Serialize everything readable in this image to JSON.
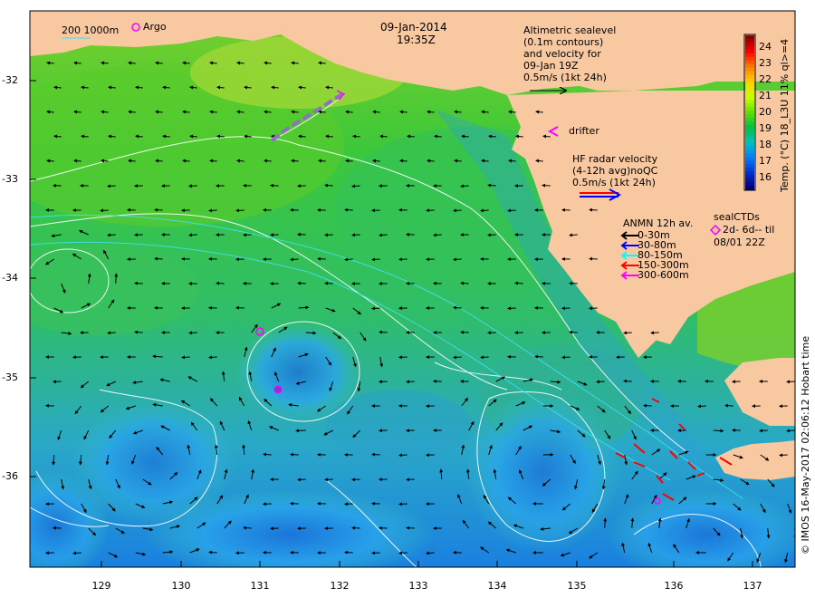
{
  "title": {
    "date": "09-Jan-2014",
    "time": "19:35Z"
  },
  "legend": {
    "bathy": "200  1000m",
    "argo": "Argo",
    "altimetry": [
      "Altimetric sealevel",
      "(0.1m contours)",
      "and velocity for",
      "09-Jan 19Z",
      "0.5m/s (1kt 24h)"
    ],
    "drifter": "drifter",
    "hf_radar": [
      "HF radar velocity",
      "(4-12h avg)noQC",
      "0.5m/s (1kt 24h)"
    ],
    "anmn_title": "ANMN 12h av.",
    "anmn_depths": [
      {
        "label": "0-30m",
        "color": "#000000"
      },
      {
        "label": "30-80m",
        "color": "#0000ff"
      },
      {
        "label": "80-150m",
        "color": "#00ffff"
      },
      {
        "label": "150-300m",
        "color": "#ff0000"
      },
      {
        "label": "300-600m",
        "color": "#ff00ff"
      }
    ],
    "seal": [
      "sealCTDs",
      "2d- 6d-- til",
      "08/01 22Z"
    ]
  },
  "axes": {
    "y_ticks": [
      "-32",
      "-33",
      "-34",
      "-35",
      "-36"
    ],
    "x_ticks": [
      "129",
      "130",
      "131",
      "132",
      "133",
      "134",
      "135",
      "136",
      "137"
    ],
    "lon_range": [
      128.2,
      137.5
    ],
    "lat_range": [
      -36.9,
      -31.3
    ]
  },
  "colorbar": {
    "title": "Temp. (°C) 18_L3U 11% ql>=4",
    "ticks": [
      "24",
      "23",
      "22",
      "21",
      "20",
      "19",
      "18",
      "17",
      "16"
    ],
    "range": [
      15.5,
      24.8
    ]
  },
  "credit": "© IMOS 16-May-2017 02:06:12 Hobart time",
  "colors": {
    "land": "#f8c8a0",
    "contour": "#ffffff",
    "argo": "#ff00ff",
    "anmn_red": "#ff0000"
  }
}
